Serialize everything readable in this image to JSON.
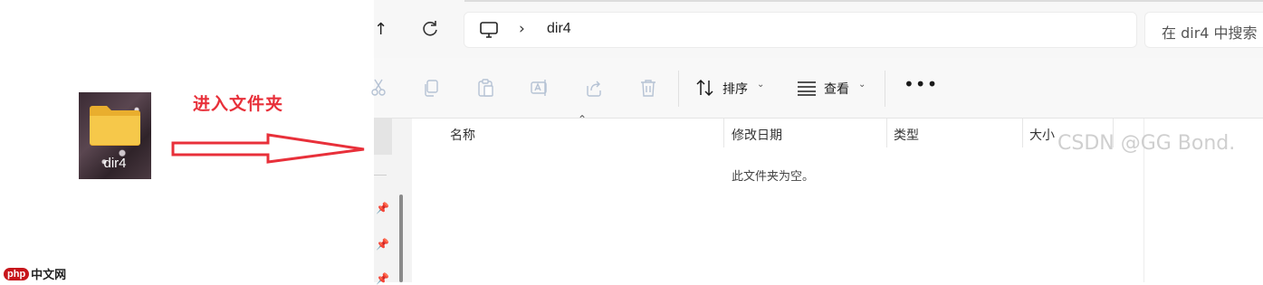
{
  "desktop": {
    "folder_label": "dir4",
    "annotation": "进入文件夹"
  },
  "logo": {
    "badge": "php",
    "text": "中文网"
  },
  "explorer": {
    "address": {
      "path_item": "dir4"
    },
    "search": {
      "placeholder": "在 dir4 中搜索"
    },
    "toolbar": {
      "sort_label": "排序",
      "view_label": "查看",
      "more_label": "•••"
    },
    "columns": [
      "名称",
      "修改日期",
      "类型",
      "大小"
    ],
    "empty_message": "此文件夹为空。"
  },
  "watermark": "CSDN @GG Bond.",
  "colors": {
    "annotation": "#e8303a",
    "arrow": "#e8303a",
    "folder": "#f6c84a"
  }
}
